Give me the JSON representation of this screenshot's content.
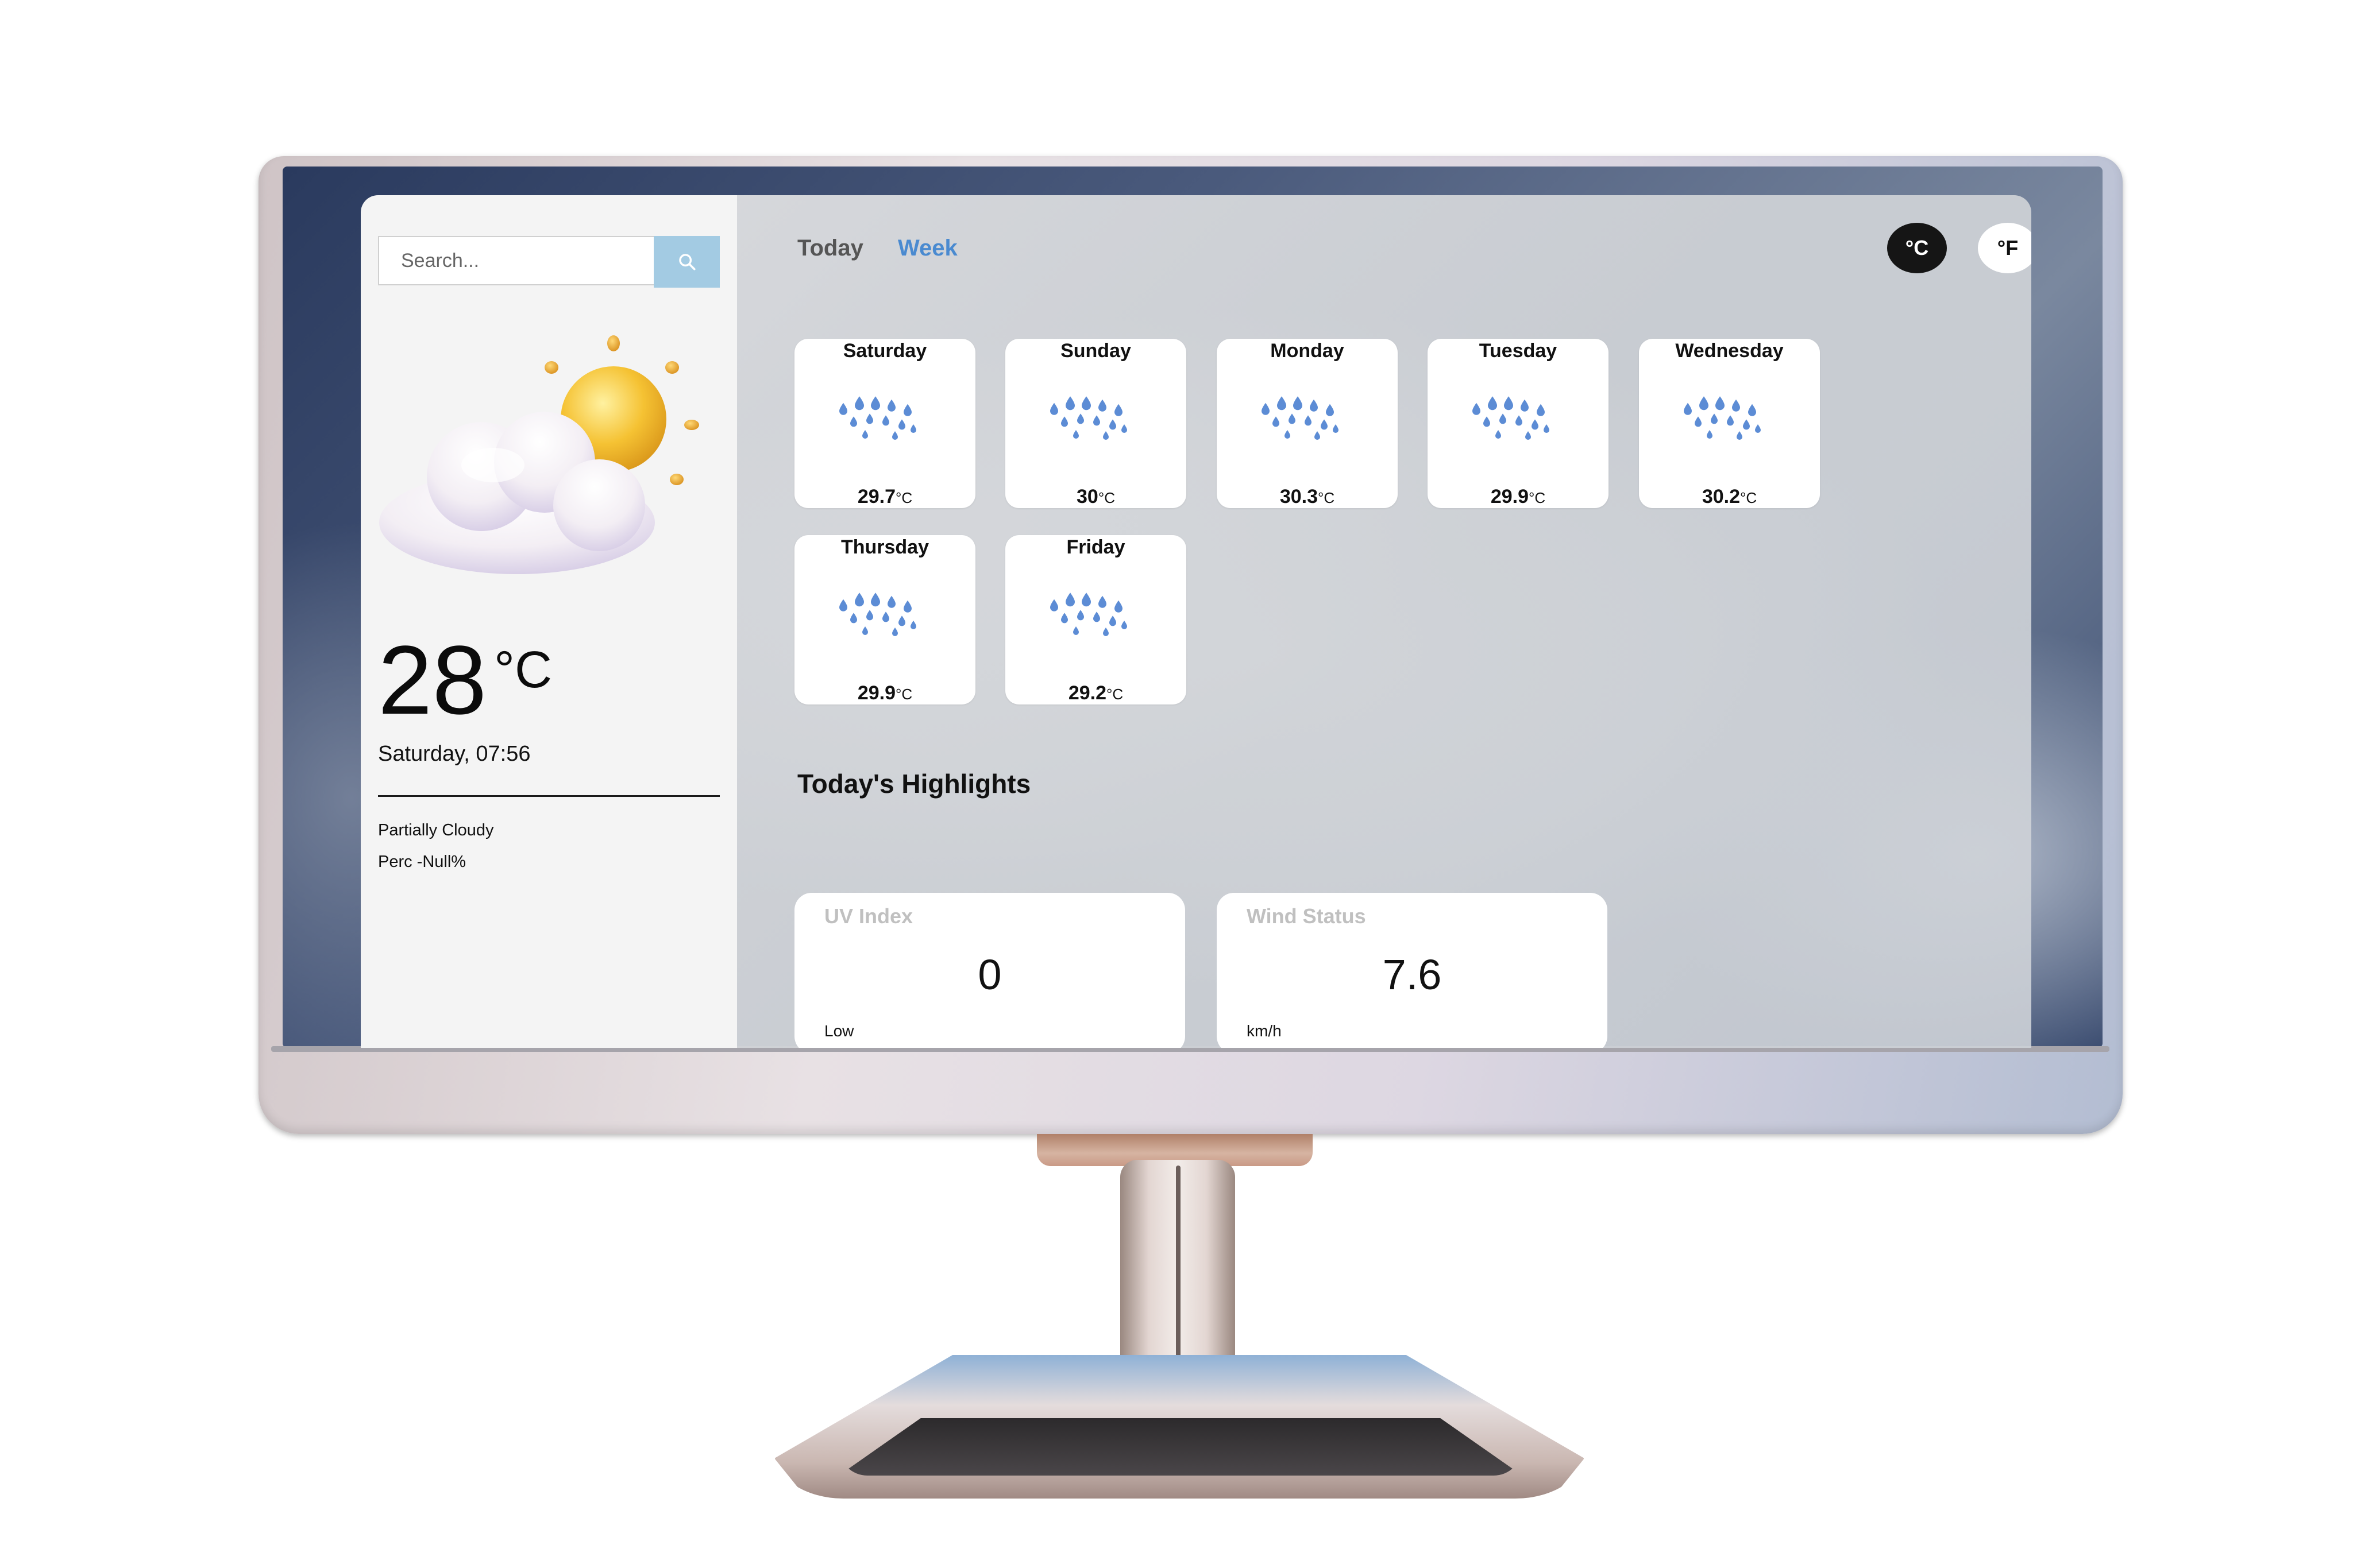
{
  "search": {
    "placeholder": "Search..."
  },
  "current": {
    "temperature": "28",
    "unit": "°C",
    "datetime": "Saturday, 07:56",
    "condition": "Partially Cloudy",
    "precipitation": "Perc -Null%",
    "icon": "partly-cloudy-icon"
  },
  "tabs": {
    "today": "Today",
    "week": "Week",
    "active": "week"
  },
  "units": {
    "celsius": "°C",
    "fahrenheit": "°F",
    "active": "celsius"
  },
  "forecast": [
    {
      "day": "Saturday",
      "temp": "29.7",
      "unit": "°C",
      "icon": "rain-icon"
    },
    {
      "day": "Sunday",
      "temp": "30",
      "unit": "°C",
      "icon": "rain-icon"
    },
    {
      "day": "Monday",
      "temp": "30.3",
      "unit": "°C",
      "icon": "rain-icon"
    },
    {
      "day": "Tuesday",
      "temp": "29.9",
      "unit": "°C",
      "icon": "rain-icon"
    },
    {
      "day": "Wednesday",
      "temp": "30.2",
      "unit": "°C",
      "icon": "rain-icon"
    },
    {
      "day": "Thursday",
      "temp": "29.9",
      "unit": "°C",
      "icon": "rain-icon"
    },
    {
      "day": "Friday",
      "temp": "29.2",
      "unit": "°C",
      "icon": "rain-icon"
    }
  ],
  "highlights": {
    "title": "Today's Highlights",
    "uv": {
      "label": "UV Index",
      "value": "0",
      "sub": "Low"
    },
    "wind": {
      "label": "Wind Status",
      "value": "7.6",
      "sub": "km/h"
    }
  },
  "colors": {
    "accent": "#4a8ad0",
    "search_button": "#a3cbe3",
    "rain_drop": "#4a7fd0",
    "active_unit_bg": "#151515"
  }
}
